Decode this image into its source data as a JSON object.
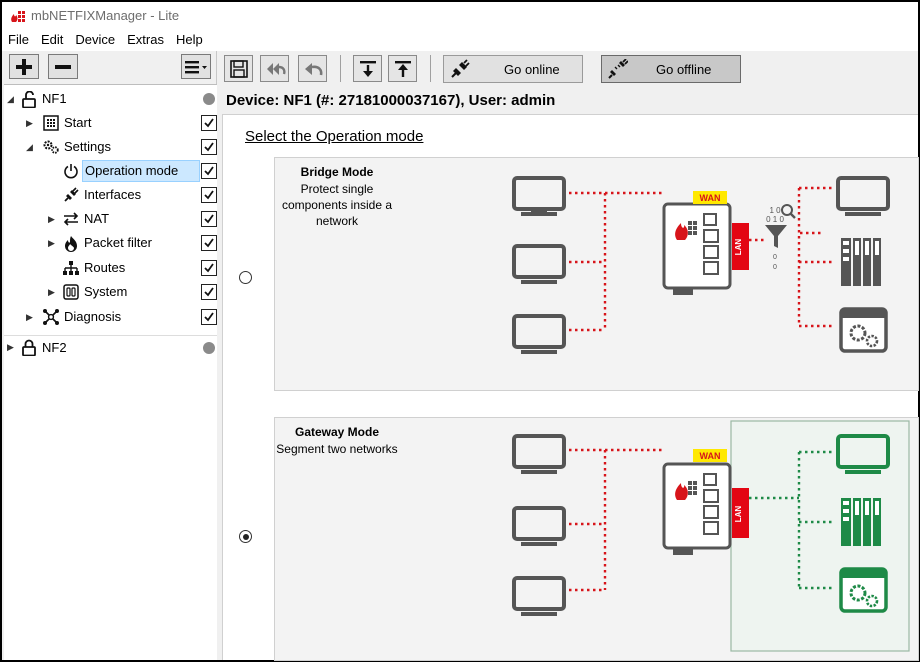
{
  "app": {
    "title": "mbNETFIXManager - Lite"
  },
  "menu": [
    "File",
    "Edit",
    "Device",
    "Extras",
    "Help"
  ],
  "left_toolbar": {
    "add_icon": "plus-icon",
    "remove_icon": "minus-icon",
    "menu_icon": "list-menu-icon"
  },
  "tree": {
    "devices": [
      {
        "label": "NF1",
        "expanded": true,
        "icon": "unlocked-padlock-icon"
      },
      {
        "label": "NF2",
        "expanded": false,
        "icon": "locked-padlock-icon"
      }
    ],
    "items": [
      {
        "label": "Start",
        "icon": "grid-icon",
        "checked": true
      },
      {
        "label": "Settings",
        "icon": "gears-icon",
        "checked": true
      },
      {
        "label": "Operation mode",
        "icon": "power-icon",
        "checked": true,
        "selected": true
      },
      {
        "label": "Interfaces",
        "icon": "plug-icon",
        "checked": true
      },
      {
        "label": "NAT",
        "icon": "swap-arrows-icon",
        "checked": true
      },
      {
        "label": "Packet filter",
        "icon": "flame-icon",
        "checked": true
      },
      {
        "label": "Routes",
        "icon": "network-tree-icon",
        "checked": true
      },
      {
        "label": "System",
        "icon": "system-icon",
        "checked": true
      },
      {
        "label": "Diagnosis",
        "icon": "diagnosis-icon",
        "checked": true
      }
    ]
  },
  "toolbar": {
    "go_online": "Go online",
    "go_offline": "Go offline",
    "active_mode": "offline"
  },
  "device_header": "Device: NF1 (#: 27181000037167), User: admin",
  "content": {
    "title": "Select the Operation mode",
    "modes": [
      {
        "name": "Bridge Mode",
        "description": "Protect single components inside a network",
        "selected": false,
        "wan_label": "WAN",
        "lan_label": "LAN",
        "filter_digits": "10\n010\n0\n0"
      },
      {
        "name": "Gateway Mode",
        "description": "Segment two networks",
        "selected": true,
        "wan_label": "WAN",
        "lan_label": "LAN"
      }
    ]
  },
  "colors": {
    "selection": "#cce8ff",
    "wan": "#ffe800",
    "lan": "#e30613",
    "firewall_red": "#d7141a",
    "gateway_green": "#1e8a47",
    "device_gray": "#555555"
  }
}
